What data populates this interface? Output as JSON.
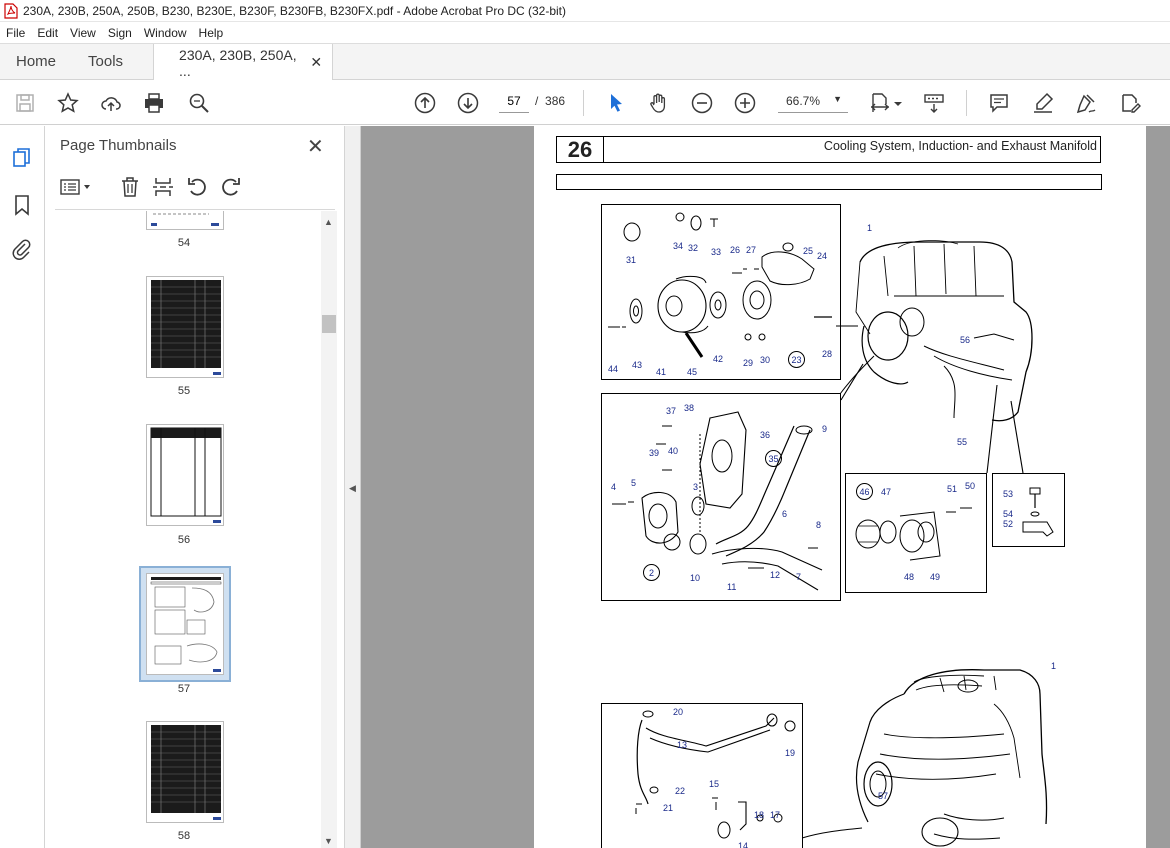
{
  "window": {
    "title": "230A, 230B, 250A, 250B, B230, B230E, B230F, B230FB, B230FX.pdf - Adobe Acrobat Pro DC (32-bit)"
  },
  "menu": [
    "File",
    "Edit",
    "View",
    "Sign",
    "Window",
    "Help"
  ],
  "tabs": {
    "home": "Home",
    "tools": "Tools",
    "document": "230A, 230B, 250A, ..."
  },
  "toolbar": {
    "current_page": "57",
    "page_separator": "/",
    "total_pages": "386",
    "zoom": "66.7%"
  },
  "thumbnails_panel": {
    "title": "Page Thumbnails",
    "pages": [
      "54",
      "55",
      "56",
      "57",
      "58"
    ],
    "selected_page": "57"
  },
  "page": {
    "section_number": "26",
    "section_title": "Cooling System, Induction- and Exhaust Manifold",
    "labels": {
      "p1": "1",
      "p2": "2",
      "p3": "3",
      "p4": "4",
      "p5": "5",
      "p6": "6",
      "p7": "7",
      "p8": "8",
      "p9": "9",
      "p10": "10",
      "p11": "11",
      "p12": "12",
      "p13": "13",
      "p14": "14",
      "p15": "15",
      "p17": "17",
      "p18": "18",
      "p19": "19",
      "p20": "20",
      "p21": "21",
      "p22": "22",
      "p23": "23",
      "p24": "24",
      "p25": "25",
      "p26": "26",
      "p27": "27",
      "p28": "28",
      "p29": "29",
      "p30": "30",
      "p31": "31",
      "p32": "32",
      "p33": "33",
      "p34": "34",
      "p35": "35",
      "p36": "36",
      "p37": "37",
      "p38": "38",
      "p39": "39",
      "p40": "40",
      "p41": "41",
      "p42": "42",
      "p43": "43",
      "p44": "44",
      "p45": "45",
      "p46": "46",
      "p47": "47",
      "p48": "48",
      "p49": "49",
      "p50": "50",
      "p51": "51",
      "p52": "52",
      "p53": "53",
      "p54": "54",
      "p55": "55",
      "p56": "56",
      "p57": "57"
    }
  },
  "colors": {
    "accent": "#1a2a8a",
    "icon": "#3a3a3a",
    "doc_background": "#9c9c9c",
    "selection": "#cfe0f1"
  }
}
